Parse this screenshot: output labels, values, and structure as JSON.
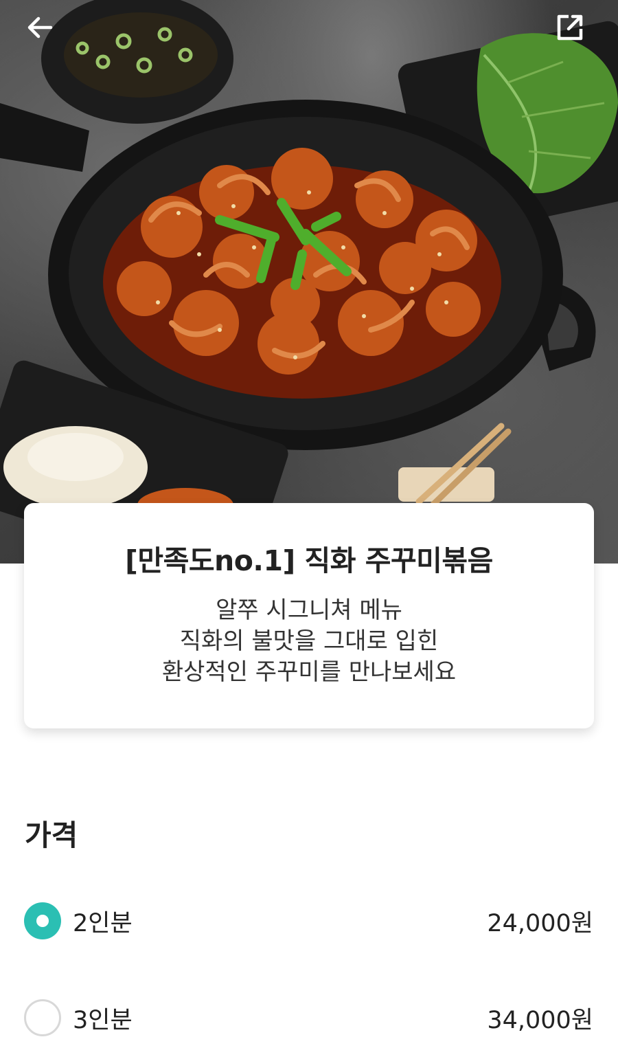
{
  "hero": {
    "back_icon": "arrow-left-icon",
    "share_icon": "external-link-icon"
  },
  "card": {
    "title": "[만족도no.1] 직화 주꾸미볶음",
    "desc_line1": "알쭈 시그니쳐 메뉴",
    "desc_line2": "직화의 불맛을 그대로 입힌",
    "desc_line3": "환상적인 주꾸미를 만나보세요"
  },
  "price": {
    "heading": "가격",
    "options": [
      {
        "label": "2인분",
        "price": "24,000원",
        "selected": true
      },
      {
        "label": "3인분",
        "price": "34,000원",
        "selected": false
      }
    ]
  },
  "colors": {
    "accent": "#2bbfb3",
    "text": "#222222"
  }
}
